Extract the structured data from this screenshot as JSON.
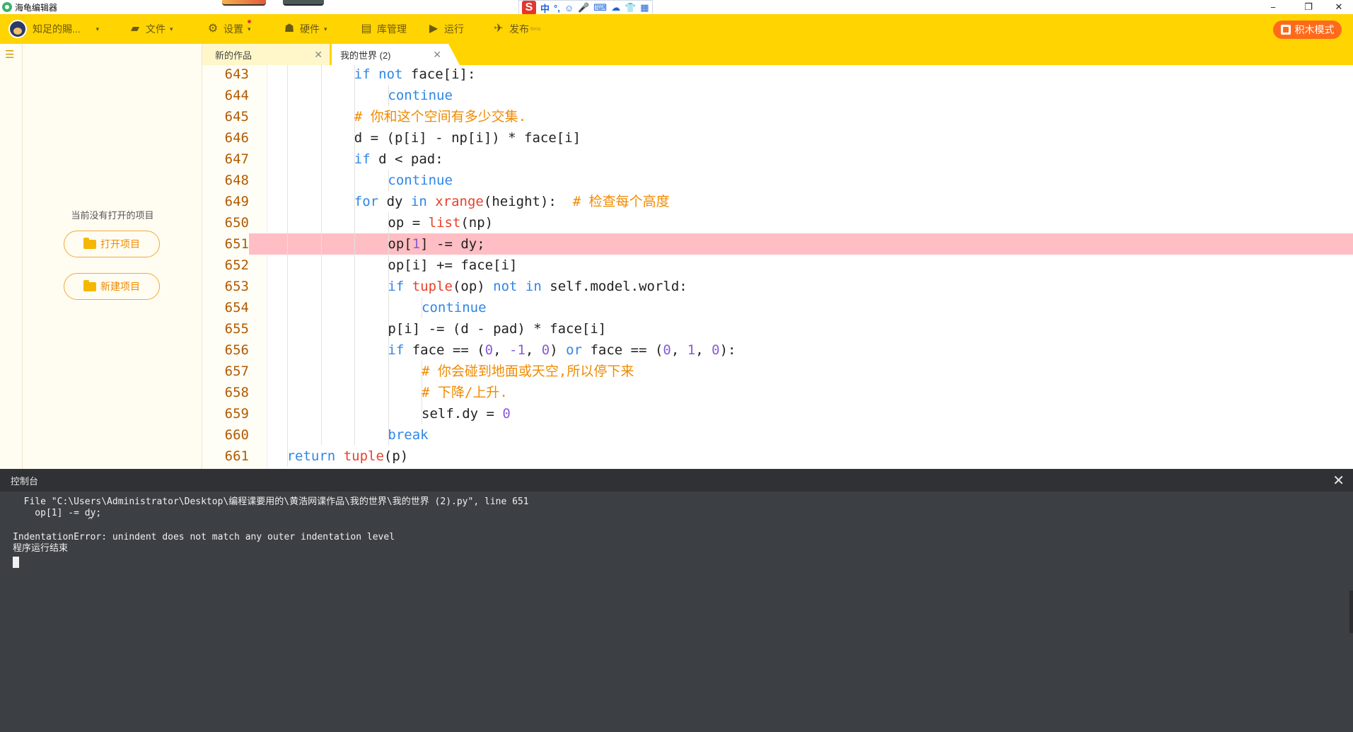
{
  "window": {
    "title": "海龟编辑器",
    "minimize": "−",
    "restore": "❐",
    "close": "✕"
  },
  "ime": {
    "logo": "S",
    "items": [
      "中",
      "°,",
      "☺",
      "🎤",
      "⌨",
      "☁",
      "👕",
      "▦"
    ]
  },
  "toolbar": {
    "user_name": "知足的賜...",
    "file": "文件",
    "settings": "设置",
    "hardware": "硬件",
    "library": "库管理",
    "run": "运行",
    "publish": "发布",
    "publish_sup": "Beta",
    "block_mode": "积木模式",
    "caret": "▾"
  },
  "project_panel": {
    "empty_text": "当前没有打开的项目",
    "open_project": "打开项目",
    "new_project": "新建项目"
  },
  "tabs": [
    {
      "label": "新的作品",
      "close": "✕",
      "active": false
    },
    {
      "label": "我的世界 (2)",
      "close": "✕",
      "active": true
    }
  ],
  "editor": {
    "error_line": 651,
    "lines": [
      {
        "n": "643",
        "indent": 4,
        "tokens": [
          [
            "kw",
            "if"
          ],
          [
            "",
            " "
          ],
          [
            "kw",
            "not"
          ],
          [
            "",
            " face[i]:"
          ]
        ]
      },
      {
        "n": "644",
        "indent": 5,
        "tokens": [
          [
            "kw",
            "continue"
          ]
        ]
      },
      {
        "n": "645",
        "indent": 4,
        "tokens": [
          [
            "cm",
            "# 你和这个空间有多少交集."
          ]
        ]
      },
      {
        "n": "646",
        "indent": 4,
        "tokens": [
          [
            "",
            "d = (p[i] - np[i]) * face[i]"
          ]
        ]
      },
      {
        "n": "647",
        "indent": 4,
        "tokens": [
          [
            "kw",
            "if"
          ],
          [
            "",
            " d < pad:"
          ]
        ]
      },
      {
        "n": "648",
        "indent": 5,
        "tokens": [
          [
            "kw",
            "continue"
          ]
        ]
      },
      {
        "n": "649",
        "indent": 4,
        "tokens": [
          [
            "kw",
            "for"
          ],
          [
            "",
            " dy "
          ],
          [
            "kw",
            "in"
          ],
          [
            "",
            " "
          ],
          [
            "bi",
            "xrange"
          ],
          [
            "",
            "(height):  "
          ],
          [
            "cm",
            "# 检查每个高度"
          ]
        ]
      },
      {
        "n": "650",
        "indent": 5,
        "tokens": [
          [
            "",
            "op = "
          ],
          [
            "bi",
            "list"
          ],
          [
            "",
            "(np)"
          ]
        ]
      },
      {
        "n": "651",
        "indent": 5,
        "tokens": [
          [
            "",
            "op["
          ],
          [
            "num",
            "1"
          ],
          [
            "",
            "] -= dy;"
          ]
        ]
      },
      {
        "n": "652",
        "indent": 5,
        "tokens": [
          [
            "",
            "op[i] += face[i]"
          ]
        ]
      },
      {
        "n": "653",
        "indent": 5,
        "tokens": [
          [
            "kw",
            "if"
          ],
          [
            "",
            " "
          ],
          [
            "bi",
            "tuple"
          ],
          [
            "",
            "(op) "
          ],
          [
            "kw",
            "not"
          ],
          [
            "",
            " "
          ],
          [
            "kw",
            "in"
          ],
          [
            "",
            " self.model.world:"
          ]
        ]
      },
      {
        "n": "654",
        "indent": 6,
        "tokens": [
          [
            "kw",
            "continue"
          ]
        ]
      },
      {
        "n": "655",
        "indent": 5,
        "tokens": [
          [
            "",
            "p[i] -= (d - pad) * face[i]"
          ]
        ]
      },
      {
        "n": "656",
        "indent": 5,
        "tokens": [
          [
            "kw",
            "if"
          ],
          [
            "",
            " face == ("
          ],
          [
            "num",
            "0"
          ],
          [
            "",
            ", "
          ],
          [
            "num",
            "-1"
          ],
          [
            "",
            ", "
          ],
          [
            "num",
            "0"
          ],
          [
            "",
            ") "
          ],
          [
            "kw",
            "or"
          ],
          [
            "",
            " face == ("
          ],
          [
            "num",
            "0"
          ],
          [
            "",
            ", "
          ],
          [
            "num",
            "1"
          ],
          [
            "",
            ", "
          ],
          [
            "num",
            "0"
          ],
          [
            "",
            "):"
          ]
        ]
      },
      {
        "n": "657",
        "indent": 6,
        "tokens": [
          [
            "cm",
            "# 你会碰到地面或天空,所以停下来"
          ]
        ]
      },
      {
        "n": "658",
        "indent": 6,
        "tokens": [
          [
            "cm",
            "# 下降/上升."
          ]
        ]
      },
      {
        "n": "659",
        "indent": 6,
        "tokens": [
          [
            "",
            "self.dy = "
          ],
          [
            "num",
            "0"
          ]
        ]
      },
      {
        "n": "660",
        "indent": 5,
        "tokens": [
          [
            "kw",
            "break"
          ]
        ]
      },
      {
        "n": "661",
        "indent": 2,
        "tokens": [
          [
            "kw",
            "return"
          ],
          [
            "",
            " "
          ],
          [
            "bi",
            "tuple"
          ],
          [
            "",
            "(p)"
          ]
        ]
      }
    ],
    "run_button": "运行"
  },
  "console": {
    "title": "控制台",
    "close": "✕",
    "lines": [
      "  File \"C:\\Users\\Administrator\\Desktop\\编程课要用的\\黄浩网课作品\\我的世界\\我的世界 (2).py\", line 651",
      "    op[1] -= dy;",
      "                ^",
      "IndentationError: unindent does not match any outer indentation level",
      "程序运行结束"
    ]
  },
  "colors": {
    "toolbar_bg": "#ffd400",
    "error_highlight": "#ffbec3",
    "keyword": "#2f86e6",
    "builtin": "#e8412a",
    "number": "#8a5ad6",
    "comment": "#f08a00",
    "line_number": "#b25a00",
    "block_mode_btn": "#ff6a1a",
    "console_bg": "#3c3f43"
  }
}
